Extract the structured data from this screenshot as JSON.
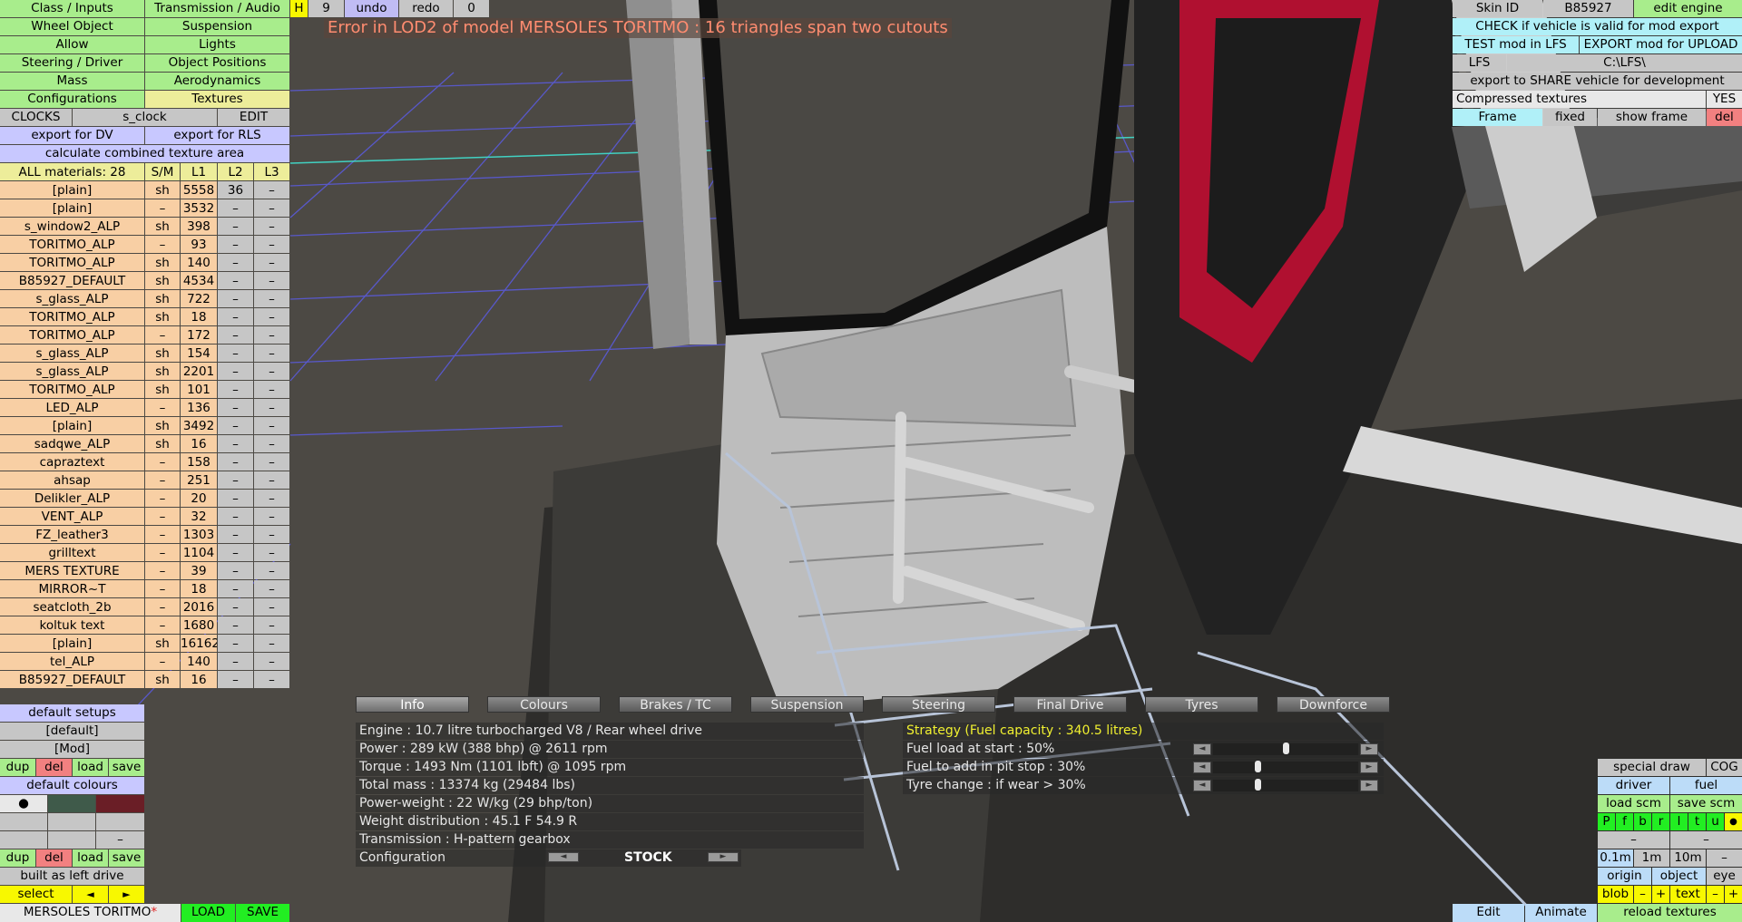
{
  "error_text": "Error in LOD2 of model MERSOLES TORITMO : 16 triangles span two cutouts",
  "left_menu": {
    "class_inputs": "Class / Inputs",
    "transmission_audio": "Transmission / Audio",
    "wheel_object": "Wheel Object",
    "suspension": "Suspension",
    "allow": "Allow",
    "lights": "Lights",
    "steering_driver": "Steering / Driver",
    "object_positions": "Object Positions",
    "mass": "Mass",
    "aerodynamics": "Aerodynamics",
    "configurations": "Configurations",
    "textures": "Textures",
    "clocks": "CLOCKS",
    "clock_name": "s_clock",
    "edit": "EDIT",
    "export_dv": "export for DV",
    "export_rls": "export for RLS",
    "calc_texture": "calculate combined texture area"
  },
  "top_bar": {
    "h": "H",
    "count": "9",
    "undo": "undo",
    "redo": "redo",
    "zero": "0"
  },
  "materials": {
    "header": {
      "name": "ALL materials: 28",
      "sm": "S/M",
      "l1": "L1",
      "l2": "L2",
      "l3": "L3"
    },
    "rows": [
      {
        "name": "[plain]",
        "sm": "sh",
        "l1": "5558",
        "l2": "36",
        "l3": "–"
      },
      {
        "name": "[plain]",
        "sm": "–",
        "l1": "3532",
        "l2": "–",
        "l3": "–"
      },
      {
        "name": "s_window2_ALP",
        "sm": "sh",
        "l1": "398",
        "l2": "–",
        "l3": "–"
      },
      {
        "name": "TORITMO_ALP",
        "sm": "–",
        "l1": "93",
        "l2": "–",
        "l3": "–"
      },
      {
        "name": "TORITMO_ALP",
        "sm": "sh",
        "l1": "140",
        "l2": "–",
        "l3": "–"
      },
      {
        "name": "B85927_DEFAULT",
        "sm": "sh",
        "l1": "4534",
        "l2": "–",
        "l3": "–"
      },
      {
        "name": "s_glass_ALP",
        "sm": "sh",
        "l1": "722",
        "l2": "–",
        "l3": "–"
      },
      {
        "name": "TORITMO_ALP",
        "sm": "sh",
        "l1": "18",
        "l2": "–",
        "l3": "–"
      },
      {
        "name": "TORITMO_ALP",
        "sm": "–",
        "l1": "172",
        "l2": "–",
        "l3": "–"
      },
      {
        "name": "s_glass_ALP",
        "sm": "sh",
        "l1": "154",
        "l2": "–",
        "l3": "–"
      },
      {
        "name": "s_glass_ALP",
        "sm": "sh",
        "l1": "2201",
        "l2": "–",
        "l3": "–"
      },
      {
        "name": "TORITMO_ALP",
        "sm": "sh",
        "l1": "101",
        "l2": "–",
        "l3": "–"
      },
      {
        "name": "LED_ALP",
        "sm": "–",
        "l1": "136",
        "l2": "–",
        "l3": "–"
      },
      {
        "name": "[plain]",
        "sm": "sh",
        "l1": "3492",
        "l2": "–",
        "l3": "–"
      },
      {
        "name": "sadqwe_ALP",
        "sm": "sh",
        "l1": "16",
        "l2": "–",
        "l3": "–"
      },
      {
        "name": "capraztext",
        "sm": "–",
        "l1": "158",
        "l2": "–",
        "l3": "–"
      },
      {
        "name": "ahsap",
        "sm": "–",
        "l1": "251",
        "l2": "–",
        "l3": "–"
      },
      {
        "name": "Delikler_ALP",
        "sm": "–",
        "l1": "20",
        "l2": "–",
        "l3": "–"
      },
      {
        "name": "VENT_ALP",
        "sm": "–",
        "l1": "32",
        "l2": "–",
        "l3": "–"
      },
      {
        "name": "FZ_leather3",
        "sm": "–",
        "l1": "1303",
        "l2": "–",
        "l3": "–"
      },
      {
        "name": "grilltext",
        "sm": "–",
        "l1": "1104",
        "l2": "–",
        "l3": "–"
      },
      {
        "name": "MERS TEXTURE",
        "sm": "–",
        "l1": "39",
        "l2": "–",
        "l3": "–"
      },
      {
        "name": "MIRROR~T",
        "sm": "–",
        "l1": "18",
        "l2": "–",
        "l3": "–"
      },
      {
        "name": "seatcloth_2b",
        "sm": "–",
        "l1": "2016",
        "l2": "–",
        "l3": "–"
      },
      {
        "name": "koltuk text",
        "sm": "–",
        "l1": "1680",
        "l2": "–",
        "l3": "–"
      },
      {
        "name": "[plain]",
        "sm": "sh",
        "l1": "16162",
        "l2": "–",
        "l3": "–"
      },
      {
        "name": "tel_ALP",
        "sm": "–",
        "l1": "140",
        "l2": "–",
        "l3": "–"
      },
      {
        "name": "B85927_DEFAULT",
        "sm": "sh",
        "l1": "16",
        "l2": "–",
        "l3": "–"
      }
    ]
  },
  "setups": {
    "default_setups": "default setups",
    "default": "[default]",
    "mod": "[Mod]",
    "dup": "dup",
    "del": "del",
    "load": "load",
    "save": "save",
    "default_colours": "default colours",
    "dot": "●",
    "dash": "–",
    "built_as": "built as left drive",
    "select": "select",
    "arrow_left": "◄",
    "arrow_right": "►"
  },
  "colour_swatches": [
    "#3f5a4a",
    "#6a1e26"
  ],
  "bottom_bar": {
    "name": "MERSOLES TORITMO",
    "star": "*",
    "load": "LOAD",
    "save": "SAVE"
  },
  "right_panel": {
    "skin_id": "Skin ID",
    "skin_value": "B85927",
    "edit_engine": "edit engine",
    "check_valid": "CHECK if vehicle is valid for mod export",
    "test_mod": "TEST mod in LFS",
    "export_mod": "EXPORT mod for UPLOAD",
    "lfs": "LFS",
    "lfs_path": "C:\\LFS\\",
    "export_share": "export to SHARE vehicle for development",
    "compressed": "Compressed textures",
    "yes": "YES",
    "frame": "Frame",
    "fixed": "fixed",
    "show_frame": "show frame",
    "del": "del"
  },
  "view_tools": {
    "special_draw": "special draw",
    "cog": "COG",
    "driver": "driver",
    "fuel": "fuel",
    "load_scm": "load scm",
    "save_scm": "save scm",
    "letters": [
      "P",
      "f",
      "b",
      "r",
      "l",
      "t",
      "u"
    ],
    "dot": "●",
    "dash": "–",
    "m01": "0.1m",
    "m1": "1m",
    "m10": "10m",
    "origin": "origin",
    "object": "object",
    "eye": "eye",
    "blob": "blob",
    "plus": "+",
    "text": "text",
    "edit": "Edit",
    "animate": "Animate",
    "reload": "reload textures"
  },
  "tabs": [
    "Info",
    "Colours",
    "Brakes / TC",
    "Suspension",
    "Steering",
    "Final Drive",
    "Tyres",
    "Downforce"
  ],
  "info": {
    "engine": "Engine : 10.7 litre turbocharged V8 / Rear wheel drive",
    "power": "Power : 289 kW (388 bhp) @ 2611 rpm",
    "torque": "Torque : 1493 Nm (1101 lbft) @ 1095 rpm",
    "mass": "Total mass : 13374 kg (29484 lbs)",
    "power_weight": "Power-weight : 22 W/kg (29 bhp/ton)",
    "weight_dist": "Weight distribution : 45.1 F  54.9 R",
    "transmission": "Transmission : H-pattern gearbox",
    "configuration": "Configuration",
    "config_value": "STOCK"
  },
  "strategy": {
    "title": "Strategy (Fuel capacity : 340.5 litres)",
    "fuel_start": "Fuel load at start : 50%",
    "fuel_pit": "Fuel to add in pit stop : 30%",
    "tyre_change": "Tyre change : if wear > 30%",
    "fuel_start_value": 0.5,
    "fuel_pit_value": 0.3,
    "tyre_change_value": 0.3
  }
}
